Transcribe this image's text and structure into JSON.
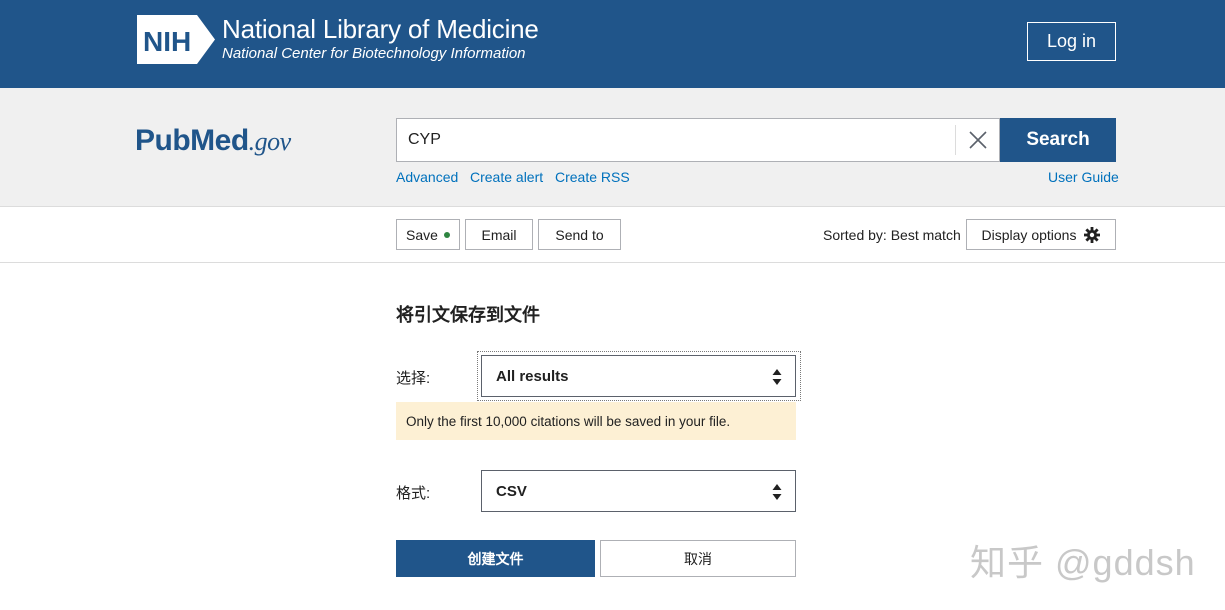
{
  "nih_header": {
    "logo_text": "NIH",
    "title": "National Library of Medicine",
    "subtitle": "National Center for Biotechnology Information",
    "login_label": "Log in",
    "background_color": "#20558a"
  },
  "search_band": {
    "logo": {
      "main": "PubMed",
      "suffix": ".gov"
    },
    "query_value": "CYP",
    "search_label": "Search",
    "links": {
      "advanced": "Advanced",
      "create_alert": "Create alert",
      "create_rss": "Create RSS",
      "user_guide": "User Guide"
    }
  },
  "toolbar": {
    "save_label": "Save",
    "email_label": "Email",
    "send_to_label": "Send to",
    "sorted_by": "Sorted by: Best match",
    "display_options_label": "Display options"
  },
  "save_panel": {
    "title": "将引文保存到文件",
    "select_label": "选择:",
    "select_value": "All results",
    "notice": "Only the first 10,000 citations will be saved in your file.",
    "format_label": "格式:",
    "format_value": "CSV",
    "create_label": "创建文件",
    "cancel_label": "取消"
  },
  "watermark": "知乎 @gddsh",
  "colors": {
    "brand_blue": "#20558a",
    "link_blue": "#0071bc",
    "notice_bg": "#fdf0d4",
    "save_dot": "#2e8540"
  }
}
